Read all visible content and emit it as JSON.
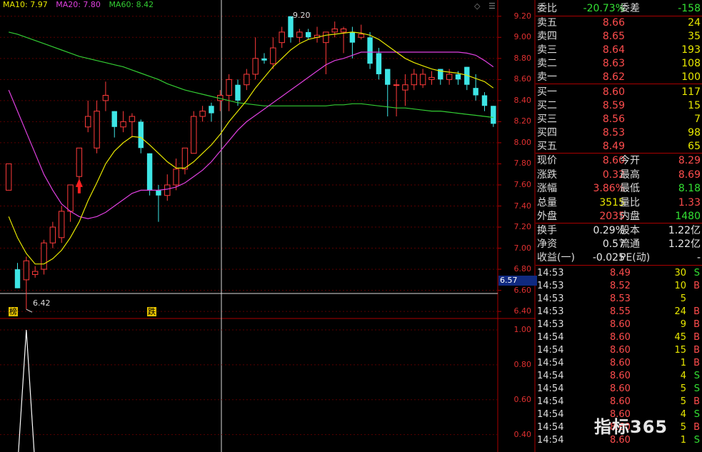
{
  "ma_legend": {
    "ma10": "MA10: 7.97",
    "ma20": "MA20: 7.80",
    "ma60": "MA60: 8.42",
    "colors": {
      "ma10": "#e8e800",
      "ma20": "#e040e0",
      "ma60": "#33cc33"
    }
  },
  "price_axis": [
    "9.20",
    "9.00",
    "8.80",
    "8.60",
    "8.40",
    "8.20",
    "8.00",
    "7.80",
    "7.60",
    "7.40",
    "7.20",
    "7.00",
    "6.80",
    "6.60",
    "6.40"
  ],
  "indicator_axis": [
    "1.00",
    "0.80",
    "0.60",
    "0.40"
  ],
  "crosshair_price": "6.57",
  "high_note": "9.20",
  "low_note": "6.42",
  "tags": {
    "bang": "榜",
    "die": "跌"
  },
  "chart_data": {
    "type": "candlestick",
    "candles": [
      {
        "o": 7.55,
        "c": 7.8,
        "h": 7.8,
        "l": 7.55
      },
      {
        "o": 6.8,
        "c": 6.62,
        "h": 6.86,
        "l": 6.62
      },
      {
        "o": 6.7,
        "c": 6.88,
        "h": 6.92,
        "l": 6.42
      },
      {
        "o": 6.75,
        "c": 6.78,
        "h": 6.83,
        "l": 6.72
      },
      {
        "o": 6.8,
        "c": 7.05,
        "h": 7.08,
        "l": 6.75
      },
      {
        "o": 7.05,
        "c": 7.2,
        "h": 7.25,
        "l": 7.0
      },
      {
        "o": 7.1,
        "c": 7.35,
        "h": 7.4,
        "l": 7.05
      },
      {
        "o": 7.35,
        "c": 7.6,
        "h": 7.6,
        "l": 7.25
      },
      {
        "o": 7.68,
        "c": 7.95,
        "h": 7.95,
        "l": 7.6
      },
      {
        "o": 8.15,
        "c": 8.25,
        "h": 8.4,
        "l": 8.1
      },
      {
        "o": 7.95,
        "c": 8.3,
        "h": 8.4,
        "l": 7.9
      },
      {
        "o": 8.4,
        "c": 8.45,
        "h": 8.58,
        "l": 8.3
      },
      {
        "o": 8.3,
        "c": 8.15,
        "h": 8.3,
        "l": 8.05
      },
      {
        "o": 8.15,
        "c": 8.2,
        "h": 8.3,
        "l": 8.1
      },
      {
        "o": 8.2,
        "c": 8.25,
        "h": 8.28,
        "l": 8.05
      },
      {
        "o": 8.2,
        "c": 7.95,
        "h": 8.22,
        "l": 7.9
      },
      {
        "o": 7.9,
        "c": 7.55,
        "h": 7.9,
        "l": 7.5
      },
      {
        "o": 7.55,
        "c": 7.5,
        "h": 7.6,
        "l": 7.25
      },
      {
        "o": 7.5,
        "c": 7.6,
        "h": 7.7,
        "l": 7.45
      },
      {
        "o": 7.6,
        "c": 7.75,
        "h": 7.85,
        "l": 7.55
      },
      {
        "o": 7.75,
        "c": 7.95,
        "h": 7.95,
        "l": 7.7
      },
      {
        "o": 7.9,
        "c": 8.25,
        "h": 8.3,
        "l": 7.9
      },
      {
        "o": 8.25,
        "c": 8.3,
        "h": 8.35,
        "l": 8.2
      },
      {
        "o": 8.35,
        "c": 8.28,
        "h": 8.38,
        "l": 8.2
      },
      {
        "o": 8.4,
        "c": 8.45,
        "h": 8.5,
        "l": 8.3
      },
      {
        "o": 8.45,
        "c": 8.6,
        "h": 8.65,
        "l": 8.3
      },
      {
        "o": 8.55,
        "c": 8.4,
        "h": 8.6,
        "l": 8.35
      },
      {
        "o": 8.55,
        "c": 8.65,
        "h": 8.7,
        "l": 8.5
      },
      {
        "o": 8.65,
        "c": 8.8,
        "h": 9.0,
        "l": 8.6
      },
      {
        "o": 8.8,
        "c": 8.78,
        "h": 8.85,
        "l": 8.75
      },
      {
        "o": 8.75,
        "c": 8.9,
        "h": 9.0,
        "l": 8.7
      },
      {
        "o": 8.95,
        "c": 9.05,
        "h": 9.1,
        "l": 8.9
      },
      {
        "o": 9.2,
        "c": 9.0,
        "h": 9.2,
        "l": 8.95
      },
      {
        "o": 9.0,
        "c": 9.05,
        "h": 9.08,
        "l": 8.95
      },
      {
        "o": 9.05,
        "c": 9.0,
        "h": 9.08,
        "l": 8.98
      },
      {
        "o": 9.0,
        "c": 9.02,
        "h": 9.1,
        "l": 8.95
      },
      {
        "o": 8.95,
        "c": 9.05,
        "h": 9.05,
        "l": 8.65
      },
      {
        "o": 9.05,
        "c": 9.08,
        "h": 9.15,
        "l": 9.0
      },
      {
        "o": 9.05,
        "c": 9.08,
        "h": 9.1,
        "l": 8.85
      },
      {
        "o": 9.05,
        "c": 8.95,
        "h": 9.1,
        "l": 8.8
      },
      {
        "o": 9.0,
        "c": 9.03,
        "h": 9.12,
        "l": 8.98
      },
      {
        "o": 9.0,
        "c": 8.75,
        "h": 9.05,
        "l": 8.7
      },
      {
        "o": 8.85,
        "c": 8.65,
        "h": 8.9,
        "l": 8.6
      },
      {
        "o": 8.7,
        "c": 8.55,
        "h": 8.7,
        "l": 8.25
      },
      {
        "o": 8.55,
        "c": 8.55,
        "h": 8.6,
        "l": 8.25
      },
      {
        "o": 8.5,
        "c": 8.55,
        "h": 8.65,
        "l": 8.35
      },
      {
        "o": 8.55,
        "c": 8.65,
        "h": 8.7,
        "l": 8.5
      },
      {
        "o": 8.55,
        "c": 8.65,
        "h": 8.7,
        "l": 8.52
      },
      {
        "o": 8.6,
        "c": 8.62,
        "h": 8.68,
        "l": 8.55
      },
      {
        "o": 8.7,
        "c": 8.6,
        "h": 8.7,
        "l": 8.55
      },
      {
        "o": 8.6,
        "c": 8.65,
        "h": 8.7,
        "l": 8.55
      },
      {
        "o": 8.65,
        "c": 8.6,
        "h": 8.68,
        "l": 8.55
      },
      {
        "o": 8.72,
        "c": 8.55,
        "h": 8.72,
        "l": 8.5
      },
      {
        "o": 8.52,
        "c": 8.45,
        "h": 8.65,
        "l": 8.4
      },
      {
        "o": 8.45,
        "c": 8.35,
        "h": 8.48,
        "l": 8.3
      },
      {
        "o": 8.35,
        "c": 8.18,
        "h": 8.35,
        "l": 8.15
      }
    ],
    "ma10": [
      7.3,
      7.1,
      6.95,
      6.85,
      6.85,
      6.9,
      6.98,
      7.1,
      7.25,
      7.45,
      7.62,
      7.8,
      7.92,
      8.0,
      8.06,
      8.05,
      7.98,
      7.9,
      7.82,
      7.76,
      7.76,
      7.82,
      7.9,
      7.98,
      8.08,
      8.2,
      8.3,
      8.4,
      8.52,
      8.62,
      8.72,
      8.8,
      8.88,
      8.94,
      8.98,
      9.0,
      9.02,
      9.03,
      9.04,
      9.05,
      9.04,
      9.02,
      8.98,
      8.92,
      8.86,
      8.8,
      8.76,
      8.73,
      8.7,
      8.68,
      8.67,
      8.66,
      8.64,
      8.61,
      8.58,
      8.52
    ],
    "ma20": [
      8.5,
      8.3,
      8.1,
      7.9,
      7.7,
      7.55,
      7.42,
      7.35,
      7.3,
      7.28,
      7.3,
      7.34,
      7.4,
      7.46,
      7.52,
      7.55,
      7.55,
      7.55,
      7.56,
      7.58,
      7.62,
      7.68,
      7.74,
      7.82,
      7.92,
      8.02,
      8.12,
      8.2,
      8.26,
      8.32,
      8.38,
      8.44,
      8.5,
      8.56,
      8.62,
      8.68,
      8.74,
      8.78,
      8.8,
      8.83,
      8.86,
      8.86,
      8.86,
      8.86,
      8.86,
      8.86,
      8.86,
      8.86,
      8.86,
      8.86,
      8.86,
      8.86,
      8.85,
      8.83,
      8.78,
      8.72
    ],
    "ma60": [
      9.05,
      9.03,
      9.0,
      8.97,
      8.94,
      8.91,
      8.88,
      8.85,
      8.82,
      8.8,
      8.78,
      8.76,
      8.74,
      8.72,
      8.69,
      8.66,
      8.63,
      8.6,
      8.56,
      8.53,
      8.5,
      8.48,
      8.46,
      8.44,
      8.42,
      8.4,
      8.38,
      8.37,
      8.36,
      8.35,
      8.35,
      8.35,
      8.35,
      8.35,
      8.35,
      8.35,
      8.35,
      8.36,
      8.36,
      8.37,
      8.37,
      8.36,
      8.35,
      8.34,
      8.33,
      8.33,
      8.32,
      8.31,
      8.3,
      8.3,
      8.29,
      8.28,
      8.27,
      8.26,
      8.25,
      8.24
    ],
    "yrange": [
      6.34,
      9.3
    ],
    "indicator_peak_index": 2,
    "indicator_range": [
      0.3,
      1.0
    ]
  },
  "quote": {
    "weibi": {
      "label": "委比",
      "val": "-20.73%",
      "label2": "委差",
      "val2": "-158"
    },
    "sells": [
      {
        "label": "卖五",
        "price": "8.66",
        "vol": "24"
      },
      {
        "label": "卖四",
        "price": "8.65",
        "vol": "35"
      },
      {
        "label": "卖三",
        "price": "8.64",
        "vol": "193"
      },
      {
        "label": "卖二",
        "price": "8.63",
        "vol": "108"
      },
      {
        "label": "卖一",
        "price": "8.62",
        "vol": "100"
      }
    ],
    "buys": [
      {
        "label": "买一",
        "price": "8.60",
        "vol": "117"
      },
      {
        "label": "买二",
        "price": "8.59",
        "vol": "15"
      },
      {
        "label": "买三",
        "price": "8.56",
        "vol": "7"
      },
      {
        "label": "买四",
        "price": "8.53",
        "vol": "98"
      },
      {
        "label": "买五",
        "price": "8.49",
        "vol": "65"
      }
    ],
    "stats": [
      {
        "l1": "现价",
        "v1": "8.60",
        "c1": "red",
        "l2": "今开",
        "v2": "8.29",
        "c2": "red"
      },
      {
        "l1": "涨跌",
        "v1": "0.32",
        "c1": "red",
        "l2": "最高",
        "v2": "8.69",
        "c2": "red"
      },
      {
        "l1": "涨幅",
        "v1": "3.86%",
        "c1": "red",
        "l2": "最低",
        "v2": "8.18",
        "c2": "green"
      },
      {
        "l1": "总量",
        "v1": "3515",
        "c1": "yellow",
        "l2": "量比",
        "v2": "1.33",
        "c2": "red"
      },
      {
        "l1": "外盘",
        "v1": "2035",
        "c1": "red",
        "l2": "内盘",
        "v2": "1480",
        "c2": "green"
      }
    ],
    "stats2": [
      {
        "l1": "换手",
        "v1": "0.29%",
        "l2": "股本",
        "v2": "1.22亿"
      },
      {
        "l1": "净资",
        "v1": "0.57",
        "l2": "流通",
        "v2": "1.22亿"
      },
      {
        "l1": "收益(一)",
        "v1": "-0.025",
        "l2": "PE(动)",
        "v2": "-"
      }
    ]
  },
  "ticks": [
    {
      "t": "14:53",
      "p": "8.49",
      "q": "30",
      "d": "S"
    },
    {
      "t": "14:53",
      "p": "8.52",
      "q": "10",
      "d": "B"
    },
    {
      "t": "14:53",
      "p": "8.53",
      "q": "5",
      "d": ""
    },
    {
      "t": "14:53",
      "p": "8.55",
      "q": "24",
      "d": "B"
    },
    {
      "t": "14:53",
      "p": "8.60",
      "q": "9",
      "d": "B"
    },
    {
      "t": "14:54",
      "p": "8.60",
      "q": "45",
      "d": "B"
    },
    {
      "t": "14:54",
      "p": "8.60",
      "q": "15",
      "d": "B"
    },
    {
      "t": "14:54",
      "p": "8.60",
      "q": "1",
      "d": "B"
    },
    {
      "t": "14:54",
      "p": "8.60",
      "q": "4",
      "d": "S"
    },
    {
      "t": "14:54",
      "p": "8.60",
      "q": "5",
      "d": "S"
    },
    {
      "t": "14:54",
      "p": "8.60",
      "q": "5",
      "d": "B"
    },
    {
      "t": "14:54",
      "p": "8.60",
      "q": "4",
      "d": "S"
    },
    {
      "t": "14:54",
      "p": "8.60",
      "q": "5",
      "d": "B"
    },
    {
      "t": "14:54",
      "p": "8.60",
      "q": "1",
      "d": "S"
    }
  ],
  "logo": "指标365"
}
